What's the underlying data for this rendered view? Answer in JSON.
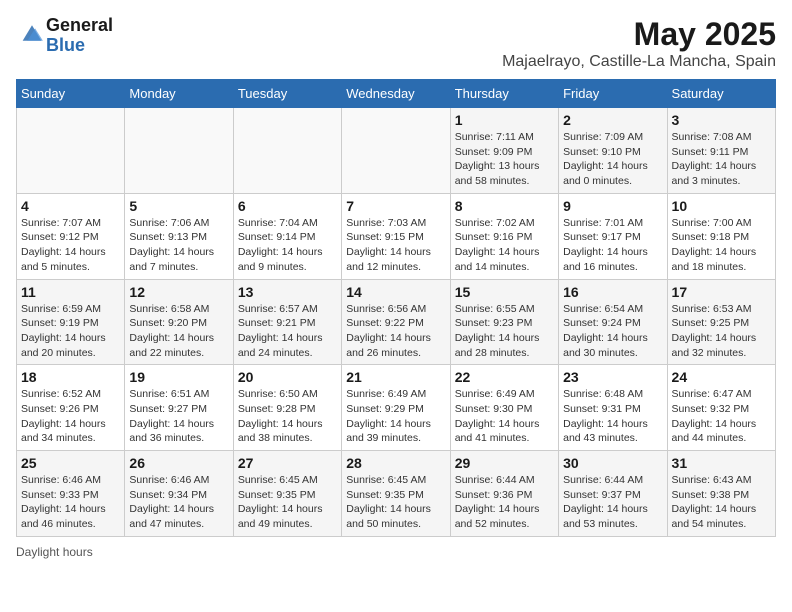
{
  "header": {
    "logo_general": "General",
    "logo_blue": "Blue",
    "main_title": "May 2025",
    "subtitle": "Majaelrayo, Castille-La Mancha, Spain"
  },
  "weekdays": [
    "Sunday",
    "Monday",
    "Tuesday",
    "Wednesday",
    "Thursday",
    "Friday",
    "Saturday"
  ],
  "weeks": [
    [
      {
        "day": "",
        "info": ""
      },
      {
        "day": "",
        "info": ""
      },
      {
        "day": "",
        "info": ""
      },
      {
        "day": "",
        "info": ""
      },
      {
        "day": "1",
        "info": "Sunrise: 7:11 AM\nSunset: 9:09 PM\nDaylight: 13 hours and 58 minutes."
      },
      {
        "day": "2",
        "info": "Sunrise: 7:09 AM\nSunset: 9:10 PM\nDaylight: 14 hours and 0 minutes."
      },
      {
        "day": "3",
        "info": "Sunrise: 7:08 AM\nSunset: 9:11 PM\nDaylight: 14 hours and 3 minutes."
      }
    ],
    [
      {
        "day": "4",
        "info": "Sunrise: 7:07 AM\nSunset: 9:12 PM\nDaylight: 14 hours and 5 minutes."
      },
      {
        "day": "5",
        "info": "Sunrise: 7:06 AM\nSunset: 9:13 PM\nDaylight: 14 hours and 7 minutes."
      },
      {
        "day": "6",
        "info": "Sunrise: 7:04 AM\nSunset: 9:14 PM\nDaylight: 14 hours and 9 minutes."
      },
      {
        "day": "7",
        "info": "Sunrise: 7:03 AM\nSunset: 9:15 PM\nDaylight: 14 hours and 12 minutes."
      },
      {
        "day": "8",
        "info": "Sunrise: 7:02 AM\nSunset: 9:16 PM\nDaylight: 14 hours and 14 minutes."
      },
      {
        "day": "9",
        "info": "Sunrise: 7:01 AM\nSunset: 9:17 PM\nDaylight: 14 hours and 16 minutes."
      },
      {
        "day": "10",
        "info": "Sunrise: 7:00 AM\nSunset: 9:18 PM\nDaylight: 14 hours and 18 minutes."
      }
    ],
    [
      {
        "day": "11",
        "info": "Sunrise: 6:59 AM\nSunset: 9:19 PM\nDaylight: 14 hours and 20 minutes."
      },
      {
        "day": "12",
        "info": "Sunrise: 6:58 AM\nSunset: 9:20 PM\nDaylight: 14 hours and 22 minutes."
      },
      {
        "day": "13",
        "info": "Sunrise: 6:57 AM\nSunset: 9:21 PM\nDaylight: 14 hours and 24 minutes."
      },
      {
        "day": "14",
        "info": "Sunrise: 6:56 AM\nSunset: 9:22 PM\nDaylight: 14 hours and 26 minutes."
      },
      {
        "day": "15",
        "info": "Sunrise: 6:55 AM\nSunset: 9:23 PM\nDaylight: 14 hours and 28 minutes."
      },
      {
        "day": "16",
        "info": "Sunrise: 6:54 AM\nSunset: 9:24 PM\nDaylight: 14 hours and 30 minutes."
      },
      {
        "day": "17",
        "info": "Sunrise: 6:53 AM\nSunset: 9:25 PM\nDaylight: 14 hours and 32 minutes."
      }
    ],
    [
      {
        "day": "18",
        "info": "Sunrise: 6:52 AM\nSunset: 9:26 PM\nDaylight: 14 hours and 34 minutes."
      },
      {
        "day": "19",
        "info": "Sunrise: 6:51 AM\nSunset: 9:27 PM\nDaylight: 14 hours and 36 minutes."
      },
      {
        "day": "20",
        "info": "Sunrise: 6:50 AM\nSunset: 9:28 PM\nDaylight: 14 hours and 38 minutes."
      },
      {
        "day": "21",
        "info": "Sunrise: 6:49 AM\nSunset: 9:29 PM\nDaylight: 14 hours and 39 minutes."
      },
      {
        "day": "22",
        "info": "Sunrise: 6:49 AM\nSunset: 9:30 PM\nDaylight: 14 hours and 41 minutes."
      },
      {
        "day": "23",
        "info": "Sunrise: 6:48 AM\nSunset: 9:31 PM\nDaylight: 14 hours and 43 minutes."
      },
      {
        "day": "24",
        "info": "Sunrise: 6:47 AM\nSunset: 9:32 PM\nDaylight: 14 hours and 44 minutes."
      }
    ],
    [
      {
        "day": "25",
        "info": "Sunrise: 6:46 AM\nSunset: 9:33 PM\nDaylight: 14 hours and 46 minutes."
      },
      {
        "day": "26",
        "info": "Sunrise: 6:46 AM\nSunset: 9:34 PM\nDaylight: 14 hours and 47 minutes."
      },
      {
        "day": "27",
        "info": "Sunrise: 6:45 AM\nSunset: 9:35 PM\nDaylight: 14 hours and 49 minutes."
      },
      {
        "day": "28",
        "info": "Sunrise: 6:45 AM\nSunset: 9:35 PM\nDaylight: 14 hours and 50 minutes."
      },
      {
        "day": "29",
        "info": "Sunrise: 6:44 AM\nSunset: 9:36 PM\nDaylight: 14 hours and 52 minutes."
      },
      {
        "day": "30",
        "info": "Sunrise: 6:44 AM\nSunset: 9:37 PM\nDaylight: 14 hours and 53 minutes."
      },
      {
        "day": "31",
        "info": "Sunrise: 6:43 AM\nSunset: 9:38 PM\nDaylight: 14 hours and 54 minutes."
      }
    ]
  ],
  "footer": {
    "note": "Daylight hours"
  }
}
